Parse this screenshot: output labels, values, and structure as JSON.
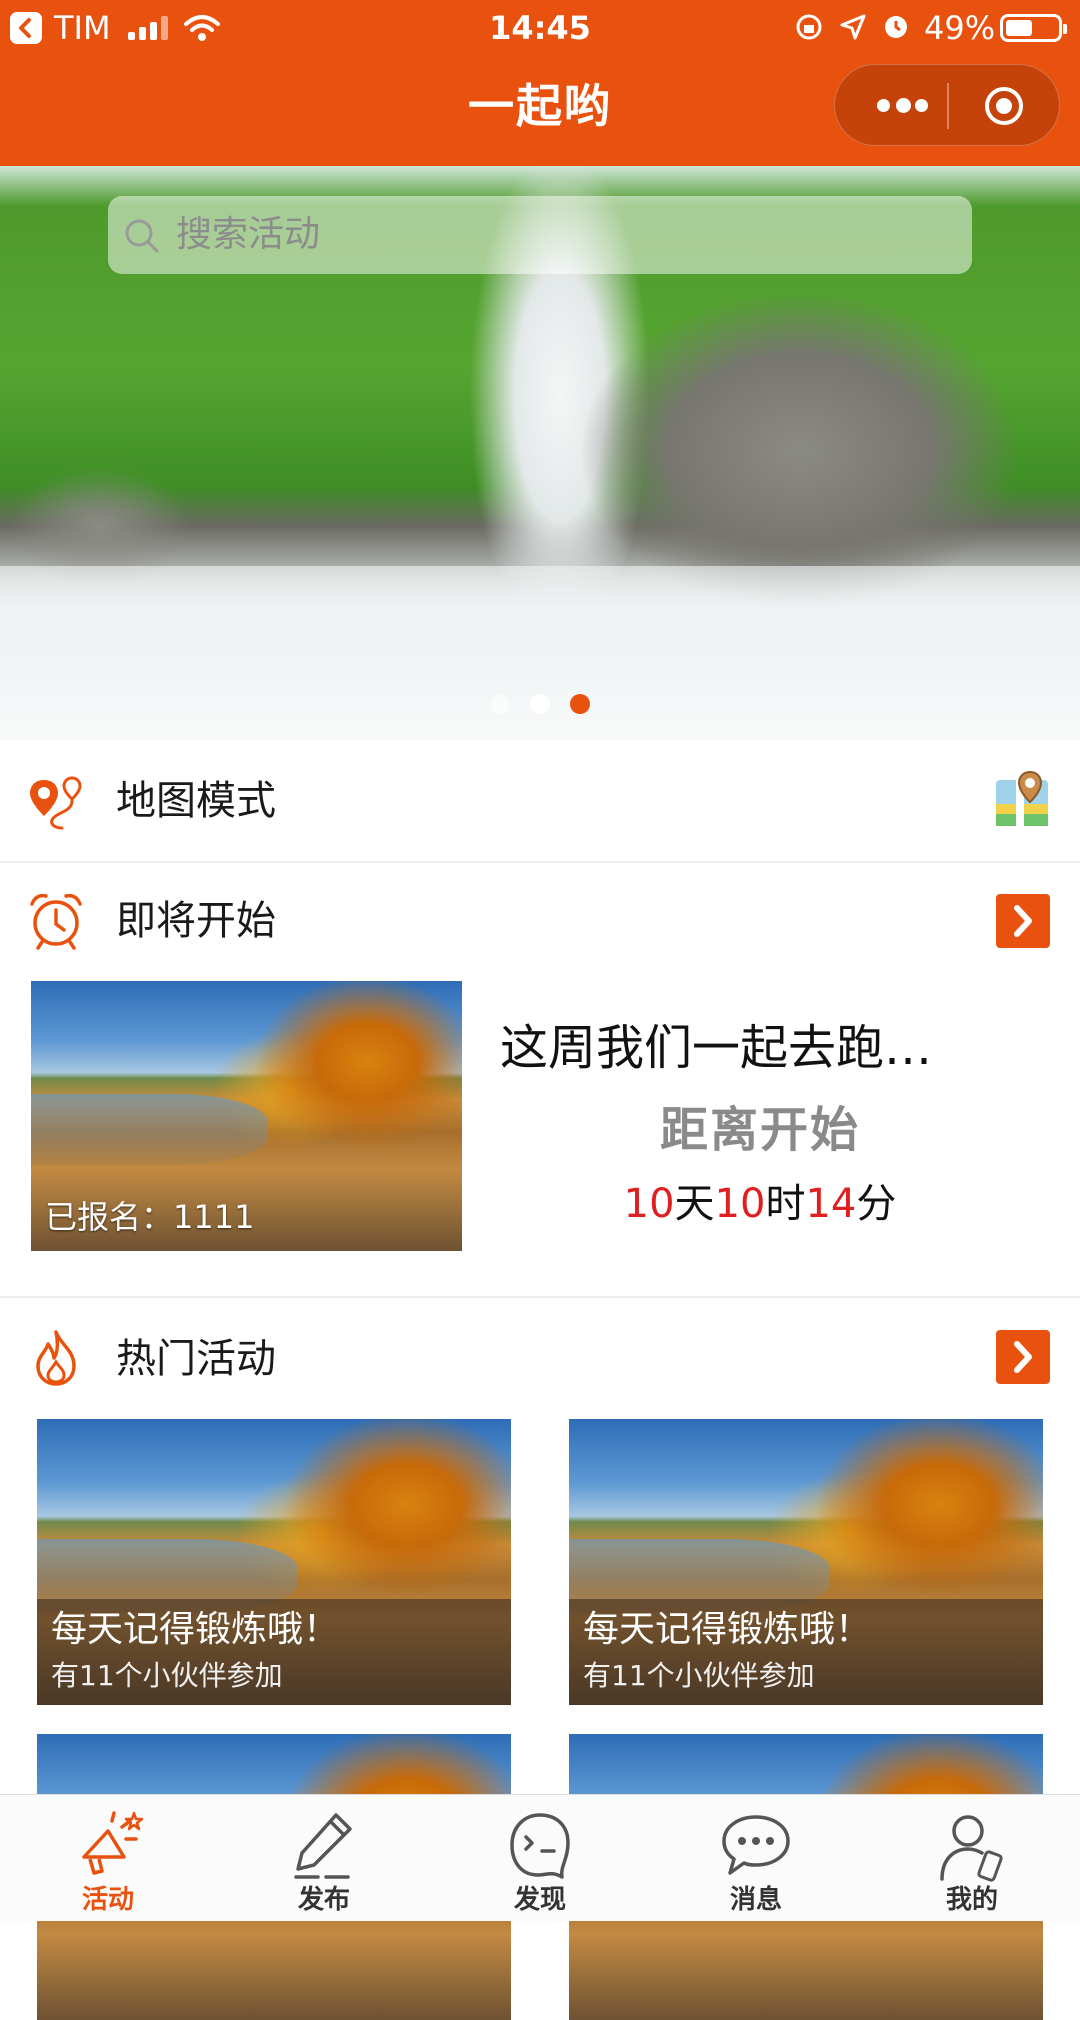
{
  "status_bar": {
    "carrier": "TIM",
    "time": "14:45",
    "battery": "49%",
    "battery_level": 0.49
  },
  "nav": {
    "title": "一起哟",
    "more_icon": "more-dots-icon",
    "close_icon": "target-circle-icon",
    "accent": "#E8520E"
  },
  "banner": {
    "search_placeholder": "搜索活动",
    "carousel_count": 3,
    "active_index": 2
  },
  "map_mode": {
    "label": "地图模式",
    "icon": "map-route-icon",
    "action_icon": "map-pin-icon"
  },
  "upcoming": {
    "label": "即将开始",
    "icon": "alarm-clock-icon",
    "event": {
      "registered": "已报名：1111",
      "title": "这周我们一起去跑…",
      "subtitle": "距离开始",
      "days": "10",
      "day_unit": "天",
      "hours": "10",
      "hour_unit": "时",
      "minutes": "14",
      "minute_unit": "分"
    }
  },
  "hot": {
    "label": "热门活动",
    "icon": "flame-icon",
    "cards": [
      {
        "title": "每天记得锻炼哦！",
        "participants": "有11个小伙伴参加"
      },
      {
        "title": "每天记得锻炼哦！",
        "participants": "有11个小伙伴参加"
      }
    ]
  },
  "tabbar": {
    "items": [
      {
        "label": "活动",
        "icon": "megaphone-icon",
        "active": true
      },
      {
        "label": "发布",
        "icon": "pen-icon",
        "active": false
      },
      {
        "label": "发现",
        "icon": "discover-face-icon",
        "active": false
      },
      {
        "label": "消息",
        "icon": "chat-bubble-icon",
        "active": false
      },
      {
        "label": "我的",
        "icon": "user-profile-icon",
        "active": false
      }
    ]
  }
}
